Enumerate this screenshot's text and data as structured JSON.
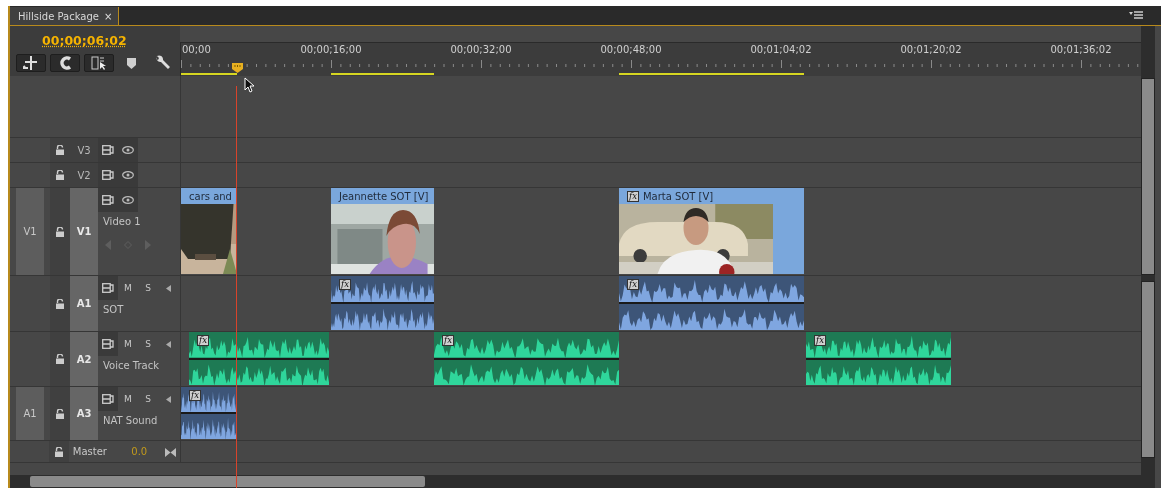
{
  "tab": {
    "title": "Hillside Package",
    "close": "×"
  },
  "timecode": "00;00;06;02",
  "ruler_labels": [
    "00;00",
    "00;00;16;00",
    "00;00;32;00",
    "00;00;48;00",
    "00;01;04;02",
    "00;01;20;02",
    "00;01;36;02"
  ],
  "tracks": [
    {
      "kind": "video",
      "name": "V3",
      "targeted": false
    },
    {
      "kind": "video",
      "name": "V2",
      "targeted": false
    },
    {
      "kind": "video",
      "source": "V1",
      "name": "V1",
      "targeted": true,
      "title": "Video 1",
      "clips": [
        {
          "title": "cars and",
          "color": "#7aa7dc"
        },
        {
          "title": "Jeannette SOT [V]",
          "color": "#7aa7dc"
        },
        {
          "title": "Marta SOT [V]",
          "badge": "fx",
          "color": "#7aa7dc"
        }
      ]
    },
    {
      "kind": "audio",
      "name": "A1",
      "targeted": true,
      "title": "SOT",
      "mute": "M",
      "solo": "S",
      "clips": [
        {
          "badge": "fx",
          "color": "#3d5578"
        },
        {
          "badge": "fx",
          "color": "#3d5578"
        }
      ]
    },
    {
      "kind": "audio",
      "name": "A2",
      "targeted": true,
      "title": "Voice Track",
      "mute": "M",
      "solo": "S",
      "clips": [
        {
          "badge": "fx",
          "color": "#2fd69b"
        },
        {
          "badge": "fx",
          "color": "#2fd69b"
        },
        {
          "badge": "fx",
          "color": "#2fd69b"
        }
      ]
    },
    {
      "kind": "audio",
      "source": "A1",
      "name": "A3",
      "targeted": true,
      "title": "NAT Sound",
      "mute": "M",
      "solo": "S",
      "clips": [
        {
          "badge": "fx",
          "color": "#3d5578"
        }
      ]
    },
    {
      "kind": "master",
      "name": "Master",
      "volume": "0.0"
    }
  ]
}
